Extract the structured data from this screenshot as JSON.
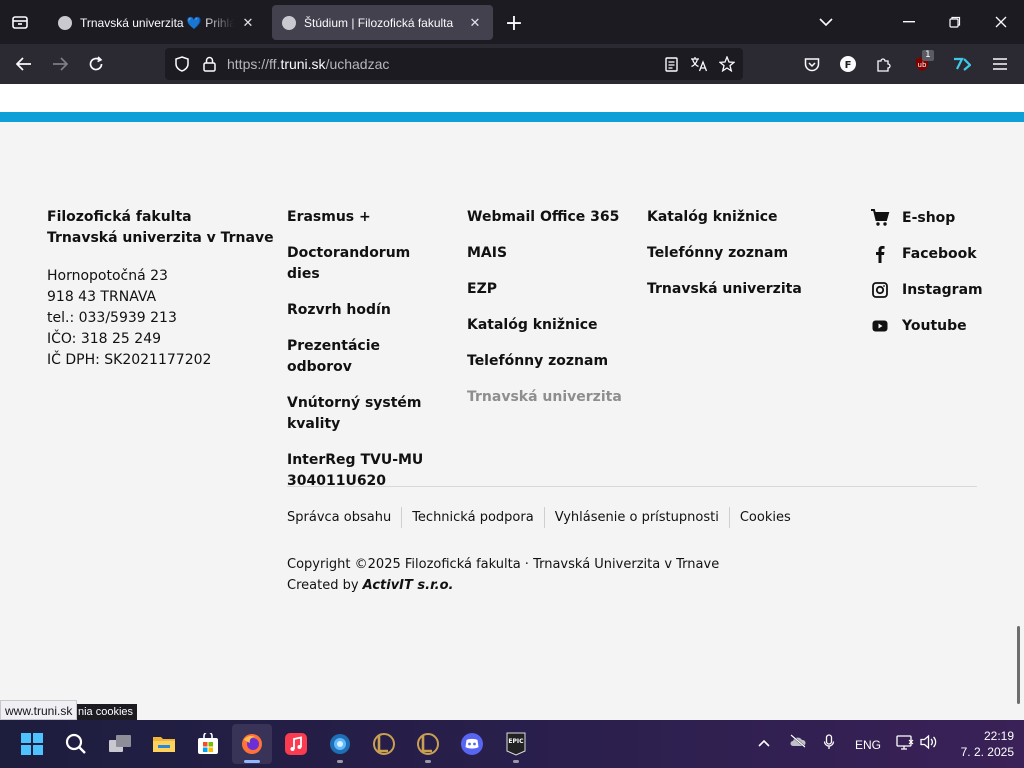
{
  "browser": {
    "tabs": [
      {
        "title": "Trnavská univerzita 💙 Prihlás sa",
        "active": false
      },
      {
        "title": "Štúdium | Filozofická fakulta",
        "active": true
      }
    ],
    "url": {
      "scheme": "https://ff.",
      "host": "truni.sk",
      "path": "/uchadzac"
    },
    "extension_badge": "1"
  },
  "footer": {
    "org_name": [
      "Filozofická fakulta",
      "Trnavská univerzita v Trnave"
    ],
    "address": [
      "Hornopotočná 23",
      "918 43 TRNAVA",
      "tel.: 033/5939 213",
      "IČO: 318 25 249",
      "IČ DPH: SK2021177202"
    ],
    "col1": [
      "Erasmus +",
      "Doctorandorum dies",
      "Rozvrh hodín",
      "Prezentácie odborov",
      "Vnútorný systém kvality",
      "InterReg TVU-MU 304011U620"
    ],
    "col2": [
      "Webmail Office 365",
      "MAIS",
      "EZP",
      "Katalóg knižnice",
      "Telefónny zoznam",
      "Trnavská univerzita"
    ],
    "col3": [
      "Katalóg knižnice",
      "Telefónny zoznam",
      "Trnavská univerzita"
    ],
    "social": [
      {
        "label": "E-shop",
        "icon": "cart-icon"
      },
      {
        "label": "Facebook",
        "icon": "facebook-icon"
      },
      {
        "label": "Instagram",
        "icon": "instagram-icon"
      },
      {
        "label": "Youtube",
        "icon": "youtube-icon"
      }
    ],
    "legal": [
      "Správca obsahu",
      "Technická podpora",
      "Vyhlásenie o prístupnosti",
      "Cookies"
    ],
    "copyright": "Copyright ©2025 Filozofická fakulta · Trnavská Univerzita v Trnave",
    "created_by_prefix": "Created by ",
    "created_by_brand": "ActivIT s.r.o."
  },
  "status": {
    "hover_url": "www.truni.sk",
    "tooltip": "nia cookies"
  },
  "taskbar": {
    "language": "ENG",
    "time": "22:19",
    "date": "7. 2. 2025"
  },
  "colors": {
    "accent_blue": "#0d9fd8",
    "page_bg": "#f4f4f4",
    "muted_link": "#8e8e8e"
  }
}
